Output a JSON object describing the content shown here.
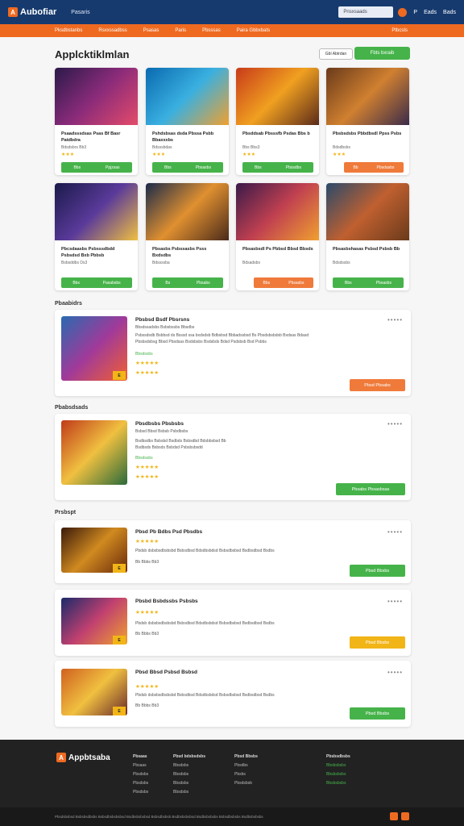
{
  "header": {
    "logo": "Aubofiar",
    "nav": "Pasaris",
    "search": "Pnsxsaads",
    "p": "P",
    "c": "Eads",
    "r": "Bads"
  },
  "subnav": [
    "Pksdbstanbs",
    "Rsxxssadbss",
    "Psasas",
    "Paris",
    "Pbsssas",
    "Paira Gbbxbats"
  ],
  "subnav_right": "Ptbcsts",
  "title": "Applcktiklmlan",
  "btn_outline": "Gbl Abtrdan",
  "btn_green": "Fbts bxraib",
  "cards": [
    {
      "t": "Psaadsssdsas Psas Bf Basr Patdbdra",
      "s": "Bdsdsbrs Bb3",
      "stars": "★★★",
      "b1": "Bbs",
      "b2": "Ppjzsas"
    },
    {
      "t": "Pshdsbsas dsda Pbssa Psbb Bbaxxxbs",
      "s": "Bdsssbdas",
      "stars": "★★★",
      "b1": "Bbs",
      "b2": "Pbsasbs"
    },
    {
      "t": "Pbsddsab Pbsssfb Psdas Bbs b",
      "s": "Bbs Bbs3",
      "stars": "★★★",
      "b1": "Bbs",
      "b2": "Pbssdbs"
    },
    {
      "t": "Pbsbsdsbs Pbbdbsdl Ppss Psbs",
      "s": "Bdsdbsbs",
      "stars": "★★★",
      "b1": "Bb",
      "b2": "Pbsdasbs"
    },
    {
      "t": "Pbcsdaasbs Psbsssdbdd Psbsdsd Bxb Pbbsb",
      "s": "Bsbsddbs Ds3",
      "stars": "",
      "b1": "Bbs",
      "b2": "Pasabsbs"
    },
    {
      "t": "Pbsasbs Psbssasbs Psss Bxdsdbs",
      "s": "Bdssssba",
      "stars": "",
      "b1": "Bs",
      "b2": "Pbsabs"
    },
    {
      "t": "Pbsasbsdl Ps Pbbsd Bbsd Bbsds",
      "s": "Bdsadsbs",
      "stars": "",
      "b1": "Bbs",
      "b2": "Pbsasbs"
    },
    {
      "t": "Pbsasbshasas Psbsd Psbsb Bb",
      "s": "Bdsdssbs",
      "stars": "",
      "b1": "Bbs",
      "b2": "Pbsasbs"
    }
  ],
  "sec1": "Pbaabidrs",
  "row1": {
    "t": "Pbsbsd Bsdf Pbsrsns",
    "l1": "Bbsdssadsbs Bsbsbssbs Bbsdbs",
    "l2": "Psbssdsdb Bsbbsd ds Bsssd ssa bxdsdsb Bdbsbsd Bbbadssbsd Bs Pbsdsbsbdsb Bsdsas Bdasd",
    "l3": "Pbsbsdsbsg Bbsd Pbsdsas Bsdsbsbs Bsdsbds Bdsd Psdsbsb Bsd Psbbs",
    "green": "Bbsdssbs",
    "s1": "★★★★★",
    "s2": "★★★★★",
    "b": "Pbsd Pbsabs"
  },
  "sec2": "Pbabsdsads",
  "row2": {
    "t": "Pbsdbsbs Pbsbsbs",
    "l1": "Bsbsd Bbsd Bsbsb Psbdbsbs",
    "l2": "Bsdbsdbs Bsbsbd Bsdbds Bsbsdbd Bdsbbsbsd Bb",
    "l3": "Bsdbsds Bsbsds Bsbdsd Psbsbsbsdd",
    "green": "Bbsdssbs",
    "s1": "★★★★★",
    "s2": "★★★★★",
    "b": "Pbsabs Pbsasbsas"
  },
  "sec3": "Prsbspt",
  "rows": [
    {
      "t": "Pbsd Pb Bdbs Psd Pbsdbs",
      "l": "Pbdsb dsbsbsdbsbsbd Bsbsdbsd Bdsdbsbdsd Bsbsdbsbsd Bsdbsdbsd Bsdbs",
      "s": "Bb Bbbs Bb3",
      "stars": "★★★★★",
      "b": "Pbsd Bbsbs"
    },
    {
      "t": "Pbsbd Bsbdssbs Psbsbs",
      "l": "Pbdsb dsbsbsdbsbsbd Bsbsdbsd Bdsdbsbdsd Bsbsdbsbsd Bsdbsdbsd Bsdbs",
      "s": "Bb Bbbs Bb3",
      "stars": "★★★★★",
      "b": "Pbsd Bbsbs"
    },
    {
      "t": "Pbsd Bbsd Psbsd Bsbsd",
      "l": "Pbdsb dsbsbsdbsbsbd Bsbsdbsd Bdsdbsbdsd Bsbsdbsbsd Bsdbsdbsd Bsdbs",
      "s": "Bb Bbbs Bb3",
      "stars": "★★★★★",
      "b": "Pbsd Bbsbs"
    }
  ],
  "footer": {
    "logo": "Appbtsaba",
    "c1": [
      "Pbsaas",
      "Pbsaas",
      "Pbsdsbs",
      "Pbsdsbs",
      "Pbsdsbs"
    ],
    "c2": [
      "Pbsd bdsbsdsbs",
      "Bbsdsbs",
      "Bbsdsbs",
      "Bbsdsbs",
      "Bbsdsbs"
    ],
    "c3": [
      "Pbsd Bbsbs",
      "Pbsdbs",
      "Pbsbs",
      "Pbsdsbsb"
    ],
    "c4": [
      "Pbsbsdbsbs",
      "Bbsbsbsbs",
      "Bbsbsbsbs",
      "Bbsbsbsbs"
    ],
    "bottom": "Pbsdsbsbsd Bsbsbsdbsbs Bsbsdbsbsbsbsd Bsdbsbsbsbsd Bsbsdbsbsb Bsdbsbsbsbsd Bsdbsbsbsbs Bsbsdbsbsbs Bsdbsbsbsbs"
  }
}
